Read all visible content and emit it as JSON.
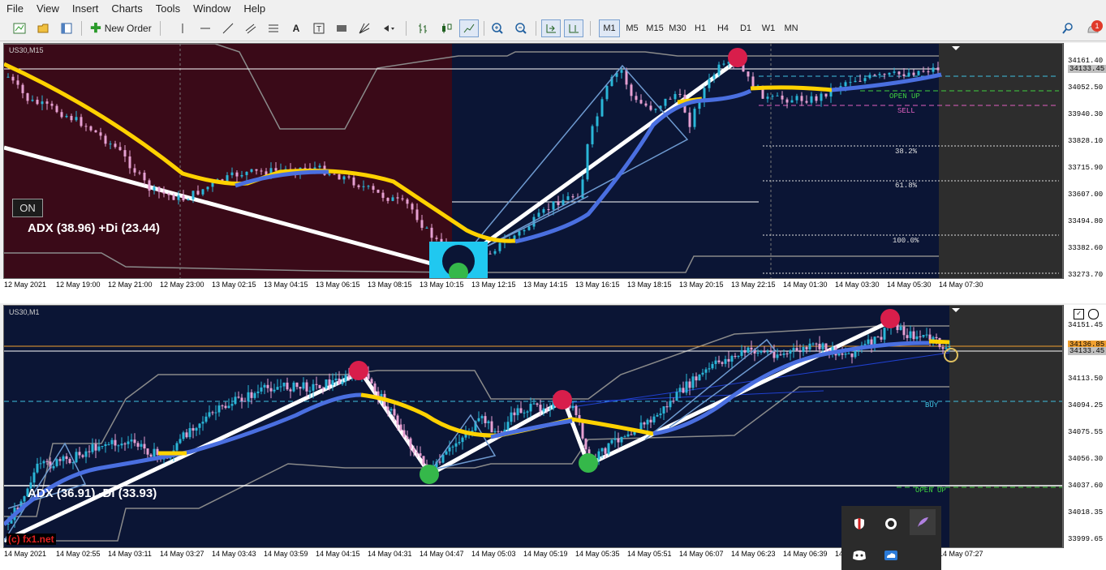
{
  "menu": [
    "File",
    "View",
    "Insert",
    "Charts",
    "Tools",
    "Window",
    "Help"
  ],
  "toolbar": {
    "new_order": "New Order",
    "timeframes": [
      "M1",
      "M5",
      "M15",
      "M30",
      "H1",
      "H4",
      "D1",
      "W1",
      "MN"
    ],
    "active_timeframe": "M1",
    "notification_count": "1"
  },
  "top_chart": {
    "symbol": "US30,M15",
    "on_label": "ON",
    "adx": "ADX (38.96)   +Di (23.44)",
    "adx_color": "#276b2e",
    "levels": {
      "open_up": "OPEN UP",
      "sell": "SELL",
      "fib382": "38.2%",
      "fib618": "61.8%",
      "fib100": "100.0%"
    },
    "price_labels": [
      "34161.40",
      "34133.45",
      "34052.50",
      "33940.30",
      "33828.10",
      "33715.90",
      "33607.00",
      "33494.80",
      "33382.60",
      "33273.70"
    ],
    "current_price": "34133.45",
    "time_labels": [
      "12 May 2021",
      "12 May 19:00",
      "12 May 21:00",
      "12 May 23:00",
      "13 May 02:15",
      "13 May 04:15",
      "13 May 06:15",
      "13 May 08:15",
      "13 May 10:15",
      "13 May 12:15",
      "13 May 14:15",
      "13 May 16:15",
      "13 May 18:15",
      "13 May 20:15",
      "13 May 22:15",
      "14 May 01:30",
      "14 May 03:30",
      "14 May 05:30",
      "14 May 07:30"
    ]
  },
  "bottom_chart": {
    "symbol": "US30,M1",
    "adx": "ADX (36.91)  -Di (33.93)",
    "adx_color": "#8b2f2f",
    "levels": {
      "buy": "BUY",
      "open_up": "OPEN UP"
    },
    "watermark": "(c) fx1.net",
    "price_labels": [
      "34151.45",
      "34133.45",
      "34113.50",
      "34094.25",
      "34075.55",
      "34056.30",
      "34037.60",
      "34018.35",
      "33999.65"
    ],
    "current_price": "34133.45",
    "bid_price": "34136.85",
    "time_labels": [
      "14 May 2021",
      "14 May 02:55",
      "14 May 03:11",
      "14 May 03:27",
      "14 May 03:43",
      "14 May 03:59",
      "14 May 04:15",
      "14 May 04:31",
      "14 May 04:47",
      "14 May 05:03",
      "14 May 05:19",
      "14 May 05:35",
      "14 May 05:51",
      "14 May 06:07",
      "14 May 06:23",
      "14 May 06:39",
      "14 May 06:55",
      "14 May 07:11",
      "14 May 07:27"
    ]
  },
  "colors": {
    "chart_bg": "#0b1535",
    "red_zone": "#3a0a18",
    "up_candle": "#2ab6d8",
    "down_candle": "#e6a0d2",
    "ma_yellow": "#ffd200",
    "ma_blue": "#4a6fe0",
    "channel": "#8a8a8a",
    "zigzag": "#6e9ad0"
  }
}
